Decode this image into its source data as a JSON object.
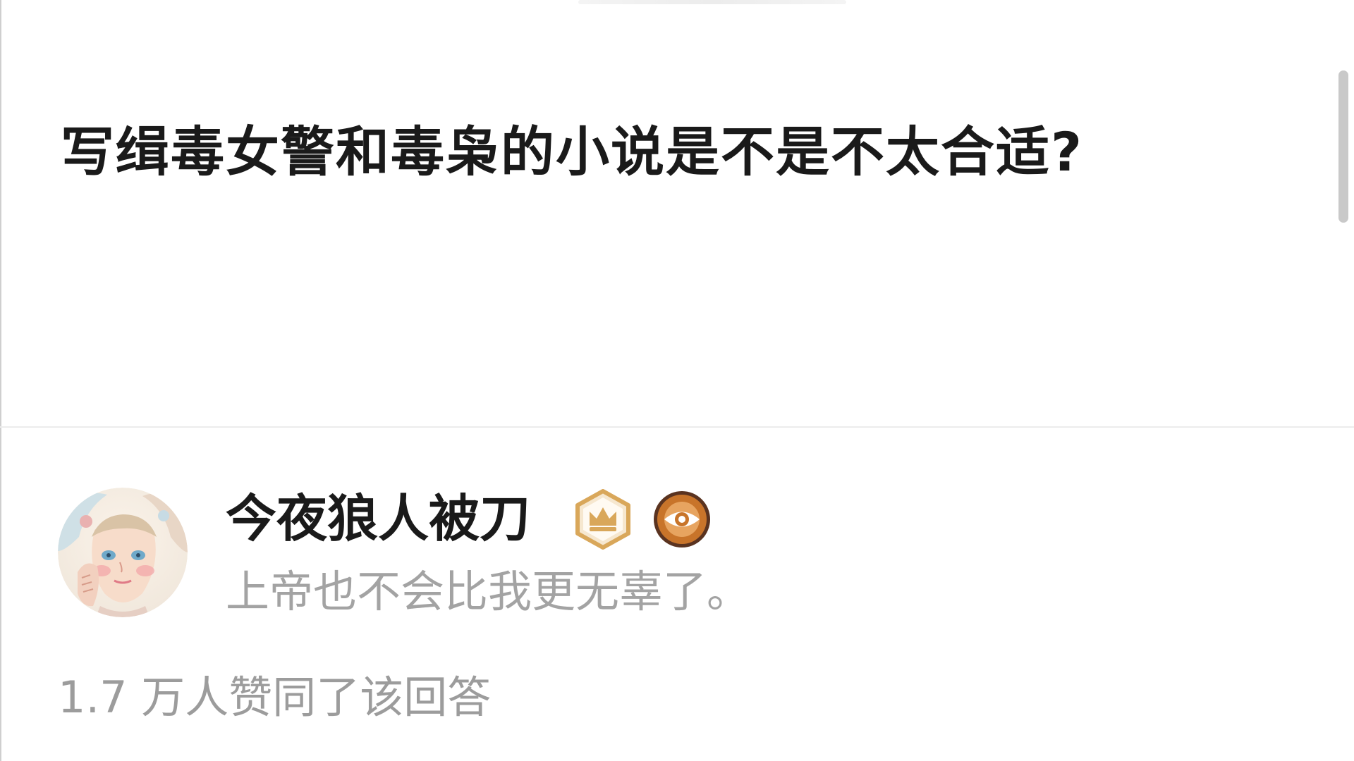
{
  "question": {
    "title": "写缉毒女警和毒枭的小说是不是不太合适?"
  },
  "answer": {
    "author": {
      "name": "今夜狼人被刀",
      "bio": "上帝也不会比我更无辜了。",
      "avatar_icon": "illustrated-girl-avatar",
      "badges": [
        "crown-badge-icon",
        "eye-badge-icon"
      ]
    },
    "vote_summary": "1.7 万人赞同了该回答"
  },
  "colors": {
    "title_text": "#1a1a1a",
    "secondary_text": "#a3a3a3",
    "crown_badge_gold": "#d9a75a",
    "eye_badge_orange": "#c8742a",
    "divider": "#ececec"
  }
}
